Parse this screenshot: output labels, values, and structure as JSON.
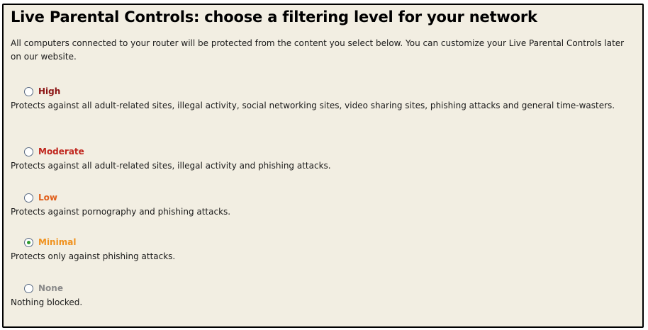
{
  "title": "Live Parental Controls: choose a filtering level for your network",
  "intro": "All computers connected to your router will be protected from the content you select below.  You can customize your Live Parental Controls later on our website.",
  "selected": "Minimal",
  "options": [
    {
      "label": "High",
      "color": "#8b1414",
      "checked": false,
      "description": "Protects against all adult-related sites, illegal activity, social networking sites, video sharing sites, phishing attacks and general time-wasters."
    },
    {
      "label": "Moderate",
      "color": "#c0261e",
      "checked": false,
      "description": "Protects against all adult-related sites, illegal activity and phishing attacks."
    },
    {
      "label": "Low",
      "color": "#e05e1a",
      "checked": false,
      "description": "Protects against pornography and phishing attacks."
    },
    {
      "label": "Minimal",
      "color": "#f0921f",
      "checked": true,
      "description": "Protects only against phishing attacks."
    },
    {
      "label": "None",
      "color": "#8a8a8a",
      "checked": false,
      "description": "Nothing blocked."
    }
  ]
}
